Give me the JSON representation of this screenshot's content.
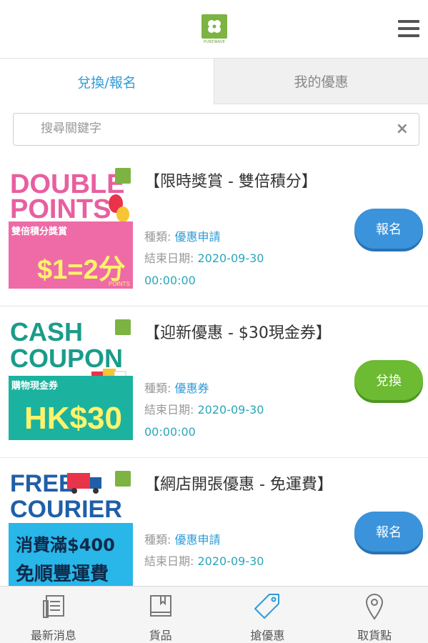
{
  "header": {
    "logo_text": "PUREWAVE",
    "menu_icon": "hamburger-menu-icon"
  },
  "tabs": [
    {
      "label": "兌換/報名",
      "active": true
    },
    {
      "label": "我的優惠",
      "active": false
    }
  ],
  "search": {
    "placeholder": "搜尋關鍵字",
    "value": "",
    "clear_icon": "×"
  },
  "offers": [
    {
      "title": "【限時獎賞 - 雙倍積分】",
      "type_label": "種類:",
      "type_value": "優惠申請",
      "end_label": "結束日期:",
      "end_date": "2020-09-30",
      "end_time": "00:00:00",
      "button_label": "報名",
      "button_color": "#3a93db",
      "banner": {
        "line1": "DOUBLE",
        "line2": "POINTS",
        "sub": "雙倍積分獎賞",
        "big": "$1=2分",
        "small": "POINTS"
      }
    },
    {
      "title": "【迎新優惠 - $30現金券】",
      "type_label": "種類:",
      "type_value": "優惠券",
      "end_label": "結束日期:",
      "end_date": "2020-09-30",
      "end_time": "00:00:00",
      "button_label": "兌換",
      "button_color": "#6cbb32",
      "banner": {
        "line1": "CASH",
        "line2": "COUPON",
        "sub": "購物現金券",
        "big": "HK$30"
      }
    },
    {
      "title": "【網店開張優惠 - 免運費】",
      "type_label": "種類:",
      "type_value": "優惠申請",
      "end_label": "結束日期:",
      "end_date": "2020-09-30",
      "button_label": "報名",
      "button_color": "#3a93db",
      "banner": {
        "line1": "FREE",
        "line2": "COURIER",
        "sub": "消費滿$400",
        "sub2": "免順豐運費"
      }
    }
  ],
  "bottom_nav": [
    {
      "label": "最新消息",
      "icon": "news-icon"
    },
    {
      "label": "貨品",
      "icon": "book-icon"
    },
    {
      "label": "搶優惠",
      "icon": "tag-icon",
      "active": true
    },
    {
      "label": "取貨點",
      "icon": "location-pin-icon"
    }
  ]
}
